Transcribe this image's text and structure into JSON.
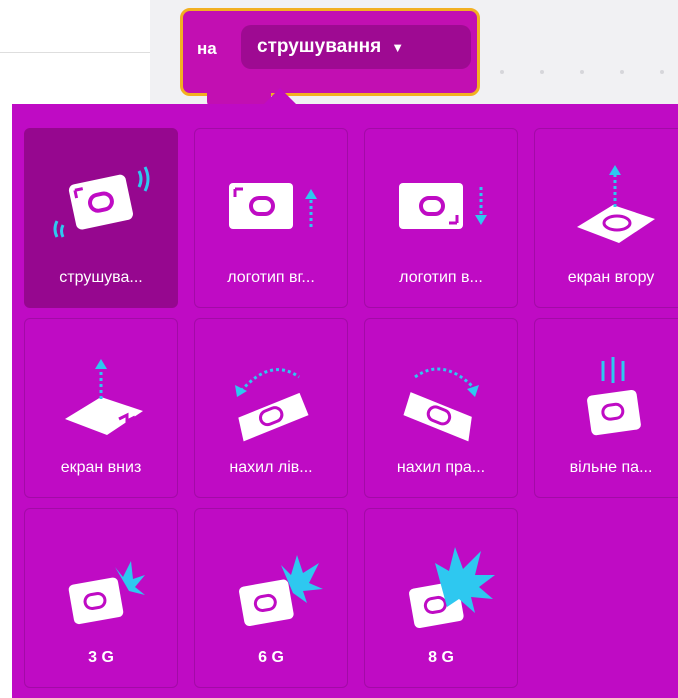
{
  "block": {
    "prefix": "на",
    "dropdown_value": "струшування",
    "dropdown_caret": "▼"
  },
  "gestures": [
    {
      "label": "струшува...",
      "icon": "shake-icon",
      "selected": true
    },
    {
      "label": "логотип вг...",
      "icon": "logo-up-icon",
      "selected": false
    },
    {
      "label": "логотип в...",
      "icon": "logo-down-icon",
      "selected": false
    },
    {
      "label": "екран вгору",
      "icon": "screen-up-icon",
      "selected": false
    },
    {
      "label": "екран вниз",
      "icon": "screen-down-icon",
      "selected": false
    },
    {
      "label": "нахил лів...",
      "icon": "tilt-left-icon",
      "selected": false
    },
    {
      "label": "нахил пра...",
      "icon": "tilt-right-icon",
      "selected": false
    },
    {
      "label": "вільне па...",
      "icon": "free-fall-icon",
      "selected": false
    },
    {
      "label": "3 G",
      "icon": "force-3g-icon",
      "selected": false
    },
    {
      "label": "6 G",
      "icon": "force-6g-icon",
      "selected": false
    },
    {
      "label": "8 G",
      "icon": "force-8g-icon",
      "selected": false
    }
  ],
  "colors": {
    "panel": "#bf0bc4",
    "selected_cell": "#96078f",
    "block": "#c20fb2",
    "block_outline": "#f2b021",
    "accent_arrow": "#2ec8f0"
  }
}
